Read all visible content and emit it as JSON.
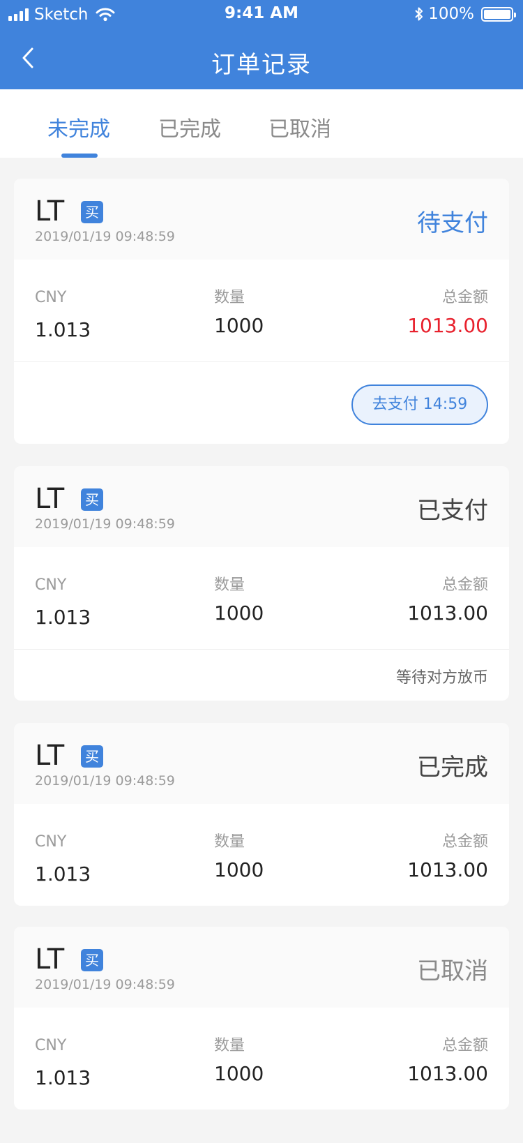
{
  "status_bar": {
    "carrier": "Sketch",
    "time": "9:41 AM",
    "battery": "100%"
  },
  "nav": {
    "title": "订单记录",
    "back_icon": "chevron-left-icon"
  },
  "tabs": [
    {
      "label": "未完成",
      "active": true
    },
    {
      "label": "已完成",
      "active": false
    },
    {
      "label": "已取消",
      "active": false
    }
  ],
  "columns": {
    "currency": "CNY",
    "quantity": "数量",
    "total": "总金额"
  },
  "orders": [
    {
      "coin": "LT",
      "side": "买",
      "time": "2019/01/19 09:48:59",
      "status": "待支付",
      "price": "1.013",
      "quantity": "1000",
      "total": "1013.00",
      "action_label": "去支付 14:59"
    },
    {
      "coin": "LT",
      "side": "买",
      "time": "2019/01/19 09:48:59",
      "status": "已支付",
      "price": "1.013",
      "quantity": "1000",
      "total": "1013.00",
      "note": "等待对方放币"
    },
    {
      "coin": "LT",
      "side": "买",
      "time": "2019/01/19 09:48:59",
      "status": "已完成",
      "price": "1.013",
      "quantity": "1000",
      "total": "1013.00"
    },
    {
      "coin": "LT",
      "side": "买",
      "time": "2019/01/19 09:48:59",
      "status": "已取消",
      "price": "1.013",
      "quantity": "1000",
      "total": "1013.00"
    }
  ],
  "colors": {
    "primary": "#4083dc",
    "pending_status": "#4083dc",
    "paid_status": "#444444",
    "done_status": "#444444",
    "cancelled_status": "#8a8a8a",
    "total_highlight": "#e8212d",
    "page_bg": "#f4f4f4"
  }
}
